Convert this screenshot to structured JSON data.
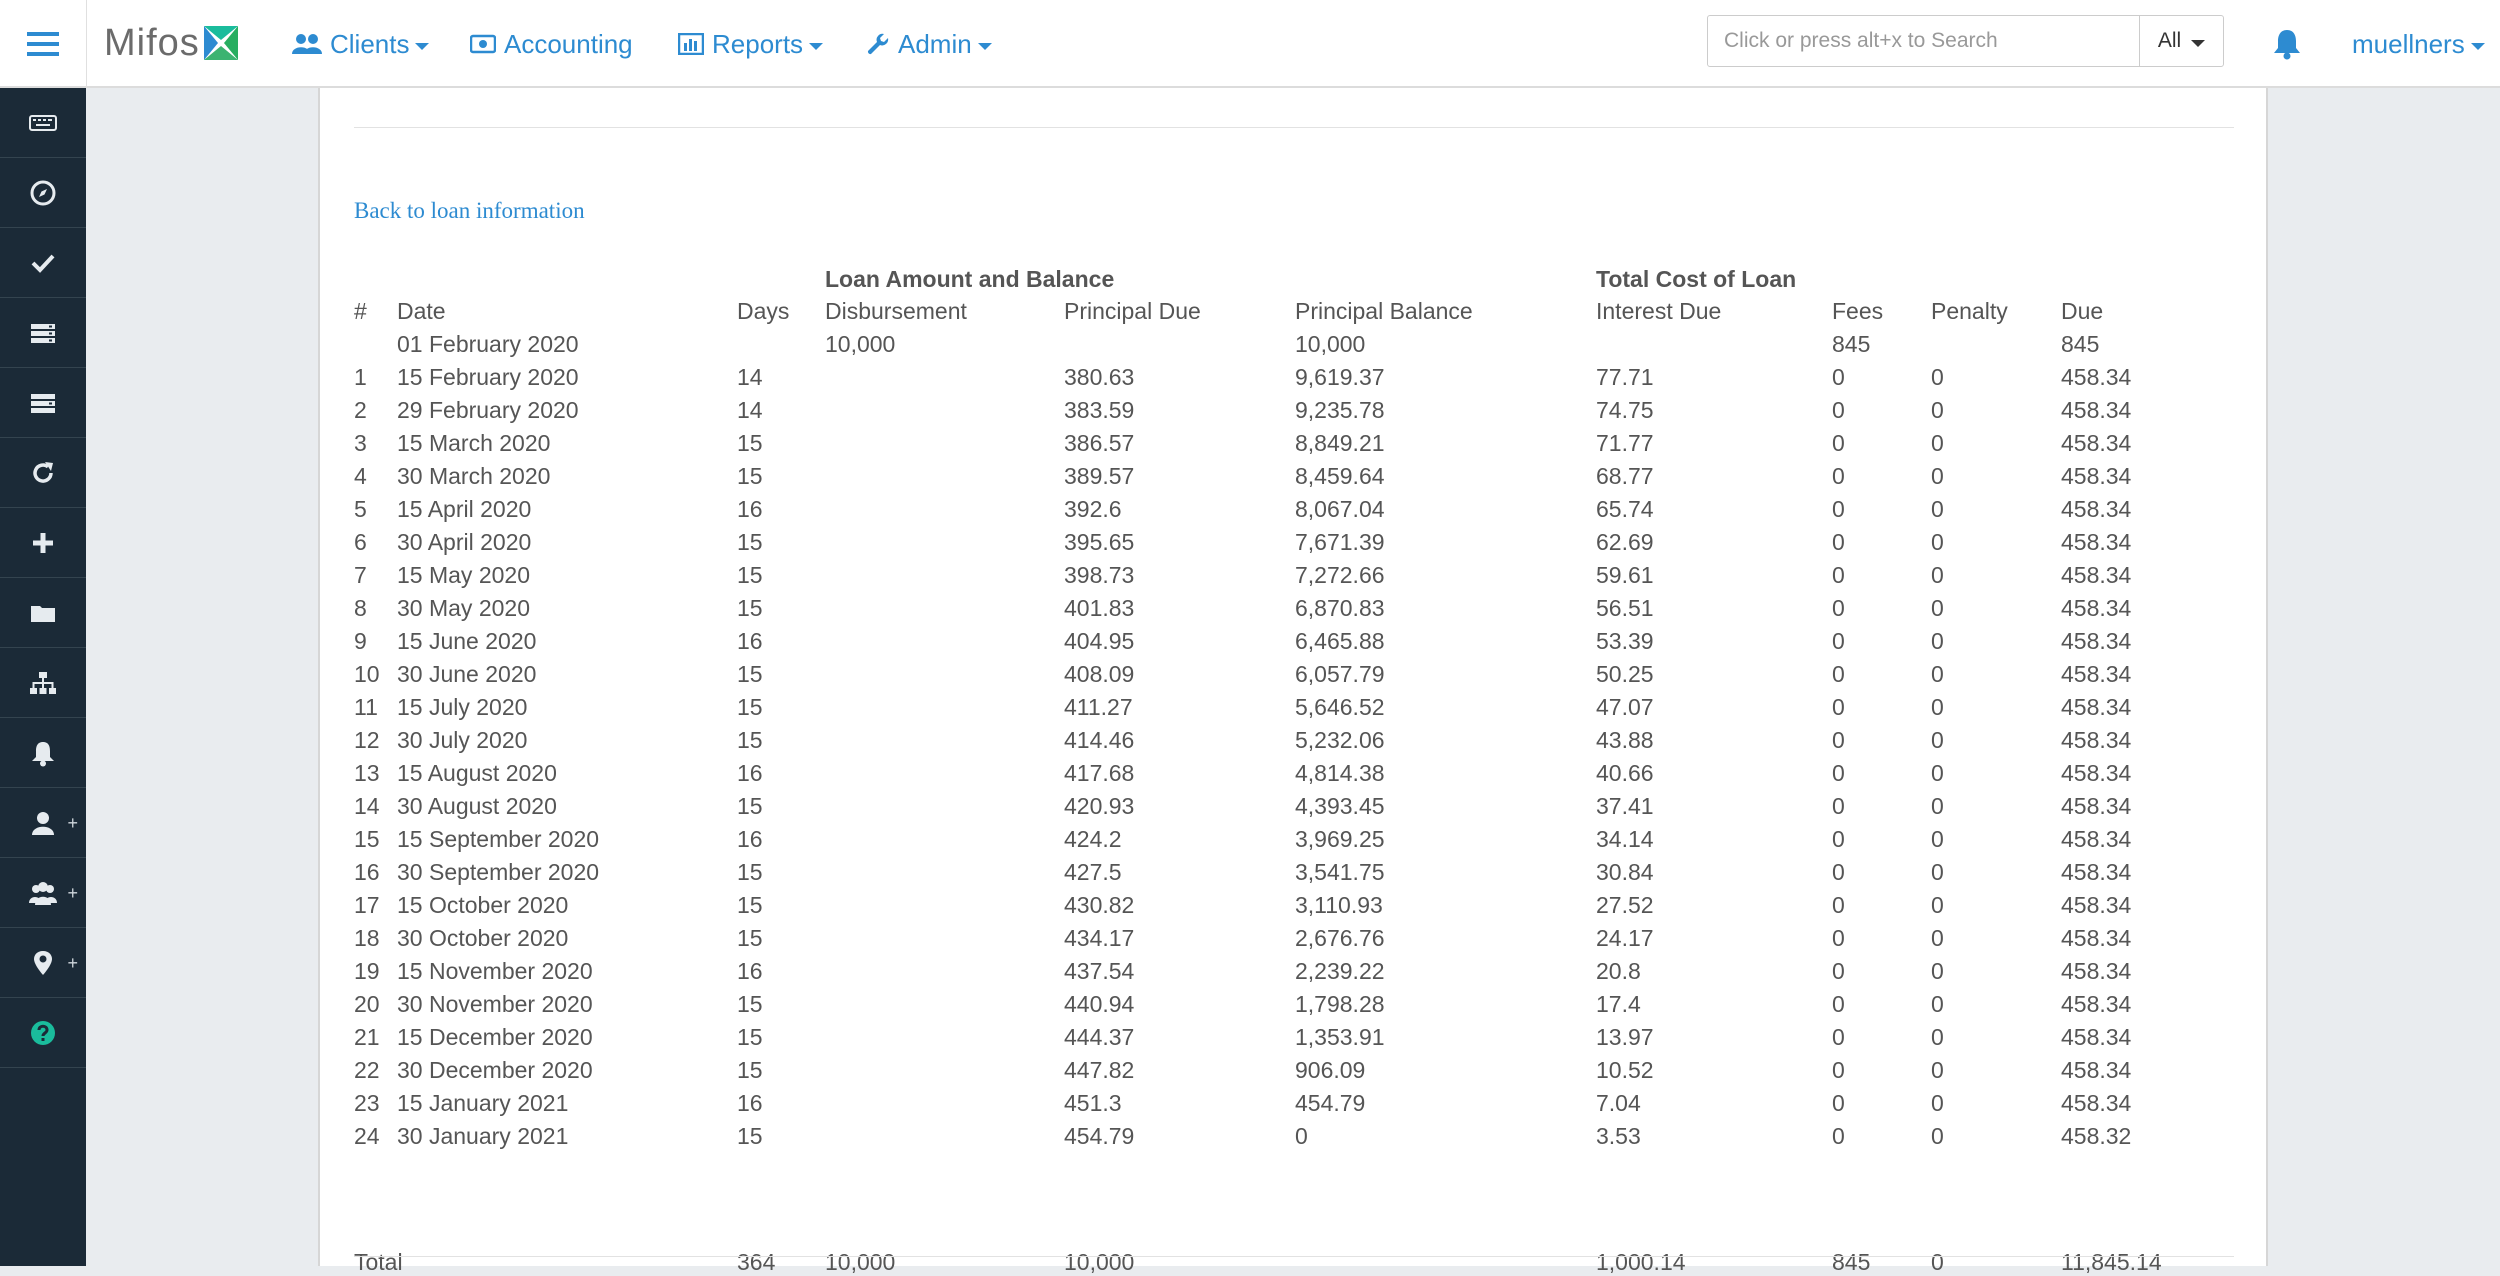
{
  "app": {
    "brand": "Mifos",
    "menu_icon": "hamburger-menu-icon"
  },
  "nav": [
    {
      "label": "Clients",
      "icon": "users-icon",
      "dropdown": true
    },
    {
      "label": "Accounting",
      "icon": "money-icon",
      "dropdown": false
    },
    {
      "label": "Reports",
      "icon": "bar-chart-icon",
      "dropdown": true
    },
    {
      "label": "Admin",
      "icon": "wrench-icon",
      "dropdown": true
    }
  ],
  "search": {
    "placeholder": "Click or press alt+x to Search",
    "scope": "All"
  },
  "user": {
    "name": "muellners"
  },
  "sidebar": [
    {
      "icon": "keyboard-icon"
    },
    {
      "icon": "compass-icon"
    },
    {
      "icon": "check-icon"
    },
    {
      "icon": "server-icon"
    },
    {
      "icon": "server-stack-icon"
    },
    {
      "icon": "refresh-icon"
    },
    {
      "icon": "plus-icon"
    },
    {
      "icon": "folder-icon"
    },
    {
      "icon": "sitemap-icon"
    },
    {
      "icon": "bell-icon"
    },
    {
      "icon": "user-add-icon",
      "plus": "+"
    },
    {
      "icon": "group-add-icon",
      "plus": "+"
    },
    {
      "icon": "map-marker-add-icon",
      "plus": "+"
    },
    {
      "icon": "help-icon"
    }
  ],
  "colors": {
    "accent": "#2d8bd1",
    "sidebar_bg": "#1b2a37",
    "help_icon": "#1abc9c"
  },
  "page": {
    "back_link": "Back to loan information"
  },
  "schedule": {
    "group_headers": {
      "loan_amount": "Loan Amount and Balance",
      "total_cost": "Total Cost of Loan"
    },
    "columns": {
      "num": "#",
      "date": "Date",
      "days": "Days",
      "disbursement": "Disbursement",
      "principal_due": "Principal Due",
      "principal_balance": "Principal Balance",
      "interest_due": "Interest Due",
      "fees": "Fees",
      "penalty": "Penalty",
      "due": "Due"
    },
    "disbursement_row": {
      "date": "01 February 2020",
      "disbursement": "10,000",
      "principal_balance": "10,000",
      "fees": "845",
      "due": "845"
    },
    "rows": [
      {
        "num": "1",
        "date": "15 February 2020",
        "days": "14",
        "principal_due": "380.63",
        "principal_balance": "9,619.37",
        "interest_due": "77.71",
        "fees": "0",
        "penalty": "0",
        "due": "458.34"
      },
      {
        "num": "2",
        "date": "29 February 2020",
        "days": "14",
        "principal_due": "383.59",
        "principal_balance": "9,235.78",
        "interest_due": "74.75",
        "fees": "0",
        "penalty": "0",
        "due": "458.34"
      },
      {
        "num": "3",
        "date": "15 March 2020",
        "days": "15",
        "principal_due": "386.57",
        "principal_balance": "8,849.21",
        "interest_due": "71.77",
        "fees": "0",
        "penalty": "0",
        "due": "458.34"
      },
      {
        "num": "4",
        "date": "30 March 2020",
        "days": "15",
        "principal_due": "389.57",
        "principal_balance": "8,459.64",
        "interest_due": "68.77",
        "fees": "0",
        "penalty": "0",
        "due": "458.34"
      },
      {
        "num": "5",
        "date": "15 April 2020",
        "days": "16",
        "principal_due": "392.6",
        "principal_balance": "8,067.04",
        "interest_due": "65.74",
        "fees": "0",
        "penalty": "0",
        "due": "458.34"
      },
      {
        "num": "6",
        "date": "30 April 2020",
        "days": "15",
        "principal_due": "395.65",
        "principal_balance": "7,671.39",
        "interest_due": "62.69",
        "fees": "0",
        "penalty": "0",
        "due": "458.34"
      },
      {
        "num": "7",
        "date": "15 May 2020",
        "days": "15",
        "principal_due": "398.73",
        "principal_balance": "7,272.66",
        "interest_due": "59.61",
        "fees": "0",
        "penalty": "0",
        "due": "458.34"
      },
      {
        "num": "8",
        "date": "30 May 2020",
        "days": "15",
        "principal_due": "401.83",
        "principal_balance": "6,870.83",
        "interest_due": "56.51",
        "fees": "0",
        "penalty": "0",
        "due": "458.34"
      },
      {
        "num": "9",
        "date": "15 June 2020",
        "days": "16",
        "principal_due": "404.95",
        "principal_balance": "6,465.88",
        "interest_due": "53.39",
        "fees": "0",
        "penalty": "0",
        "due": "458.34"
      },
      {
        "num": "10",
        "date": "30 June 2020",
        "days": "15",
        "principal_due": "408.09",
        "principal_balance": "6,057.79",
        "interest_due": "50.25",
        "fees": "0",
        "penalty": "0",
        "due": "458.34"
      },
      {
        "num": "11",
        "date": "15 July 2020",
        "days": "15",
        "principal_due": "411.27",
        "principal_balance": "5,646.52",
        "interest_due": "47.07",
        "fees": "0",
        "penalty": "0",
        "due": "458.34"
      },
      {
        "num": "12",
        "date": "30 July 2020",
        "days": "15",
        "principal_due": "414.46",
        "principal_balance": "5,232.06",
        "interest_due": "43.88",
        "fees": "0",
        "penalty": "0",
        "due": "458.34"
      },
      {
        "num": "13",
        "date": "15 August 2020",
        "days": "16",
        "principal_due": "417.68",
        "principal_balance": "4,814.38",
        "interest_due": "40.66",
        "fees": "0",
        "penalty": "0",
        "due": "458.34"
      },
      {
        "num": "14",
        "date": "30 August 2020",
        "days": "15",
        "principal_due": "420.93",
        "principal_balance": "4,393.45",
        "interest_due": "37.41",
        "fees": "0",
        "penalty": "0",
        "due": "458.34"
      },
      {
        "num": "15",
        "date": "15 September 2020",
        "days": "16",
        "principal_due": "424.2",
        "principal_balance": "3,969.25",
        "interest_due": "34.14",
        "fees": "0",
        "penalty": "0",
        "due": "458.34"
      },
      {
        "num": "16",
        "date": "30 September 2020",
        "days": "15",
        "principal_due": "427.5",
        "principal_balance": "3,541.75",
        "interest_due": "30.84",
        "fees": "0",
        "penalty": "0",
        "due": "458.34"
      },
      {
        "num": "17",
        "date": "15 October 2020",
        "days": "15",
        "principal_due": "430.82",
        "principal_balance": "3,110.93",
        "interest_due": "27.52",
        "fees": "0",
        "penalty": "0",
        "due": "458.34"
      },
      {
        "num": "18",
        "date": "30 October 2020",
        "days": "15",
        "principal_due": "434.17",
        "principal_balance": "2,676.76",
        "interest_due": "24.17",
        "fees": "0",
        "penalty": "0",
        "due": "458.34"
      },
      {
        "num": "19",
        "date": "15 November 2020",
        "days": "16",
        "principal_due": "437.54",
        "principal_balance": "2,239.22",
        "interest_due": "20.8",
        "fees": "0",
        "penalty": "0",
        "due": "458.34"
      },
      {
        "num": "20",
        "date": "30 November 2020",
        "days": "15",
        "principal_due": "440.94",
        "principal_balance": "1,798.28",
        "interest_due": "17.4",
        "fees": "0",
        "penalty": "0",
        "due": "458.34"
      },
      {
        "num": "21",
        "date": "15 December 2020",
        "days": "15",
        "principal_due": "444.37",
        "principal_balance": "1,353.91",
        "interest_due": "13.97",
        "fees": "0",
        "penalty": "0",
        "due": "458.34"
      },
      {
        "num": "22",
        "date": "30 December 2020",
        "days": "15",
        "principal_due": "447.82",
        "principal_balance": "906.09",
        "interest_due": "10.52",
        "fees": "0",
        "penalty": "0",
        "due": "458.34"
      },
      {
        "num": "23",
        "date": "15 January 2021",
        "days": "16",
        "principal_due": "451.3",
        "principal_balance": "454.79",
        "interest_due": "7.04",
        "fees": "0",
        "penalty": "0",
        "due": "458.34"
      },
      {
        "num": "24",
        "date": "30 January 2021",
        "days": "15",
        "principal_due": "454.79",
        "principal_balance": "0",
        "interest_due": "3.53",
        "fees": "0",
        "penalty": "0",
        "due": "458.32"
      }
    ],
    "total_row": {
      "label": "Total",
      "days": "364",
      "disbursement": "10,000",
      "principal_due": "10,000",
      "interest_due": "1,000.14",
      "fees": "845",
      "penalty": "0",
      "due": "11,845.14"
    }
  }
}
